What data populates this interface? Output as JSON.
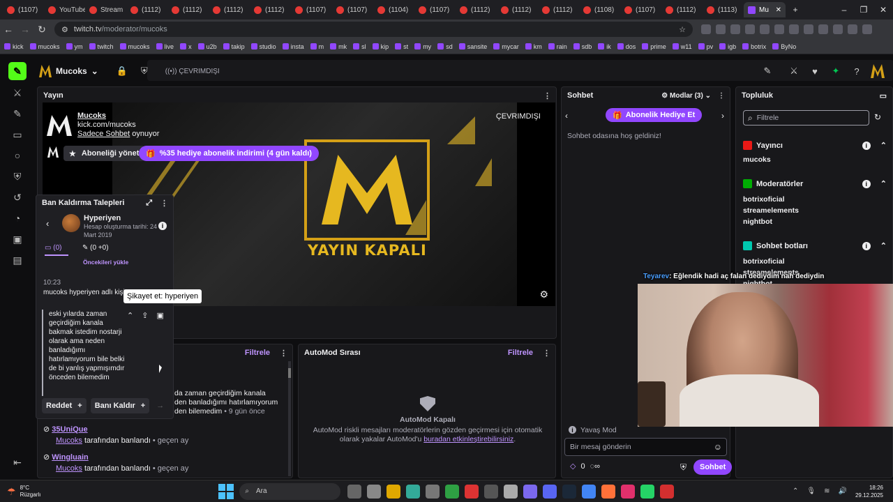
{
  "browser": {
    "tabs": [
      "(1107)",
      "YouTube",
      "Stream",
      "(1112)",
      "(1112)",
      "(1112)",
      "(1112)",
      "(1107)",
      "(1107)",
      "(1104)",
      "(1107)",
      "(1112)",
      "(1112)",
      "(1112)",
      "(1108)",
      "(1107)",
      "(1112)",
      "(1113)",
      "Mu"
    ],
    "url_host": "twitch.tv",
    "url_path": "/moderator/mucoks",
    "bookmarks": [
      "kick",
      "mucoks",
      "ym",
      "twitch",
      "mucoks",
      "live",
      "x",
      "u2b",
      "takip",
      "studio",
      "insta",
      "m",
      "mk",
      "sl",
      "kip",
      "st",
      "my",
      "sd",
      "sansite",
      "mycar",
      "km",
      "rain",
      "sdb",
      "ik",
      "dos",
      "prime",
      "w11",
      "pv",
      "igb",
      "botrix",
      "ByNo"
    ]
  },
  "topnav": {
    "channel": "Mucoks",
    "status": "ÇEVRIMDIŞI"
  },
  "stream_panel": {
    "title": "Yayın",
    "channel_name": "Mucoks",
    "channel_url": "kick.com/mucoks",
    "category": "Sadece Sohbet",
    "playing": "oynuyor",
    "offline_label": "ÇEVRIMDIŞI",
    "manage_sub": "Aboneliği yönet",
    "gift_promo": "%35 hediye abonelik indirimi (4 gün kaldı)",
    "offline_banner": "YAYIN KAPALI"
  },
  "ban_panel": {
    "title": "Ban Kaldırma Talepleri",
    "user": "Hyperiyen",
    "created_label": "Hesap oluşturma tarihi: 24 Mart 2019",
    "tab_messages": "(0)",
    "tab_mod": "(0 +0)",
    "load_prev": "Öncekileri yükle",
    "time": "10:23",
    "log_text": "mucoks hyperiyen adlı kişi",
    "request_text": "eski yılarda zaman geçirdiğim kanala bakmak istedim nostarji olarak ama neden banladığımı hatırlamıyorum bile belki de bi yanlış yapmışımdır önceden bilemedim",
    "deny": "Reddet",
    "unban": "Banı Kaldır",
    "tooltip": "Şikayet et: hyperiyen"
  },
  "bans_list": {
    "filter": "Filtrele",
    "partial_lines": [
      "da zaman geçirdiğim kanala",
      "den banladığımı hatırlamıyorum",
      "den bilemedim"
    ],
    "partial_time": "• 9 gün önce",
    "items": [
      {
        "user": "35UniQue",
        "by": "Mucoks",
        "by_suffix": "tarafından banlandı",
        "time": "• geçen ay"
      },
      {
        "user": "Wingluain",
        "by": "Mucoks",
        "by_suffix": "tarafından banlandı",
        "time": "• geçen ay"
      }
    ]
  },
  "automod": {
    "title": "AutoMod Sırası",
    "filter": "Filtrele",
    "off_title": "AutoMod Kapalı",
    "desc": "AutoMod riskli mesajları moderatörlerin gözden geçirmesi için otomatik olarak yakalar AutoMod'u",
    "link": "buradan etkinleştirebilirsiniz",
    "desc_end": "."
  },
  "chat": {
    "title": "Sohbet",
    "mods": "Modlar (3)",
    "gift": "Abonelik Hediye Et",
    "welcome": "Sohbet odasına hoş geldiniz!",
    "slow_mode": "Yavaş Mod",
    "input_placeholder": "Bir mesaj gönderin",
    "points": "0",
    "chat_button": "Sohbet"
  },
  "community": {
    "title": "Topluluk",
    "filter_placeholder": "Filtrele",
    "sections": [
      {
        "name": "Yayıncı",
        "color": "#e91916",
        "users": [
          "mucoks"
        ]
      },
      {
        "name": "Moderatörler",
        "color": "#00ad03",
        "users": [
          "botrixoficial",
          "streamelements",
          "nightbot"
        ]
      },
      {
        "name": "Sohbet botları",
        "color": "#00c8af",
        "users": [
          "botrixoficial",
          "streamelements",
          "nightbot"
        ]
      }
    ]
  },
  "overlay": {
    "name": "Teyarev",
    "message": ": Eğlendik hadi aç falan dediydim nah dediydin"
  },
  "taskbar": {
    "temp": "8°C",
    "weather": "Rüzgarlı",
    "search": "Ara",
    "time": "18:26",
    "date": "29.12.2025"
  }
}
